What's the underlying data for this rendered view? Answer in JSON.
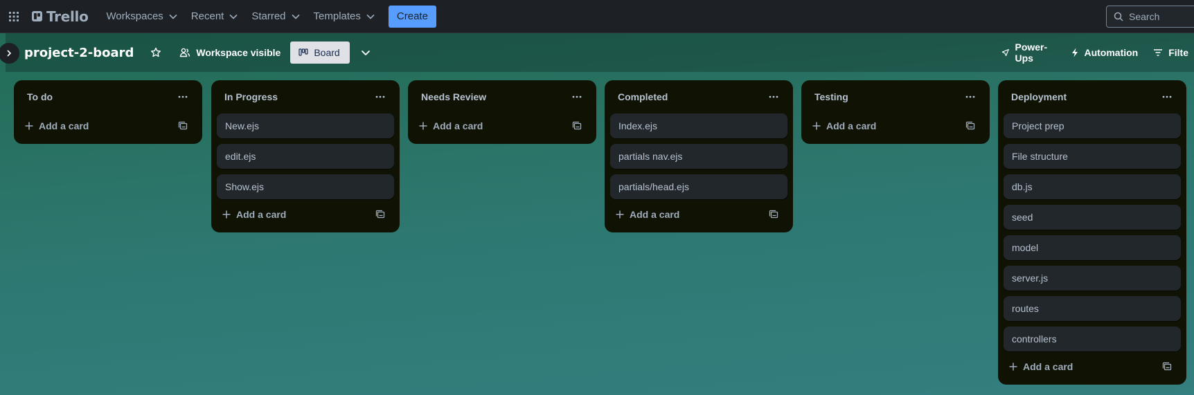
{
  "topnav": {
    "logo": "Trello",
    "menus": [
      "Workspaces",
      "Recent",
      "Starred",
      "Templates"
    ],
    "create_label": "Create",
    "search_placeholder": "Search"
  },
  "board_header": {
    "title": "project-2-board",
    "visibility_label": "Workspace visible",
    "view_label": "Board",
    "powerups_label": "Power-Ups",
    "automation_label": "Automation",
    "filter_label": "Filte"
  },
  "lists": [
    {
      "title": "To do",
      "cards": [],
      "add_label": "Add a card"
    },
    {
      "title": "In Progress",
      "cards": [
        "New.ejs",
        "edit.ejs",
        "Show.ejs"
      ],
      "add_label": "Add a card"
    },
    {
      "title": "Needs Review",
      "cards": [],
      "add_label": "Add a card"
    },
    {
      "title": "Completed",
      "cards": [
        "Index.ejs",
        "partials nav.ejs",
        "partials/head.ejs"
      ],
      "add_label": "Add a card"
    },
    {
      "title": "Testing",
      "cards": [],
      "add_label": "Add a card"
    },
    {
      "title": "Deployment",
      "cards": [
        "Project prep",
        "File structure",
        "db.js",
        "seed",
        "model",
        "server.js",
        "routes",
        "controllers"
      ],
      "add_label": "Add a card"
    }
  ]
}
